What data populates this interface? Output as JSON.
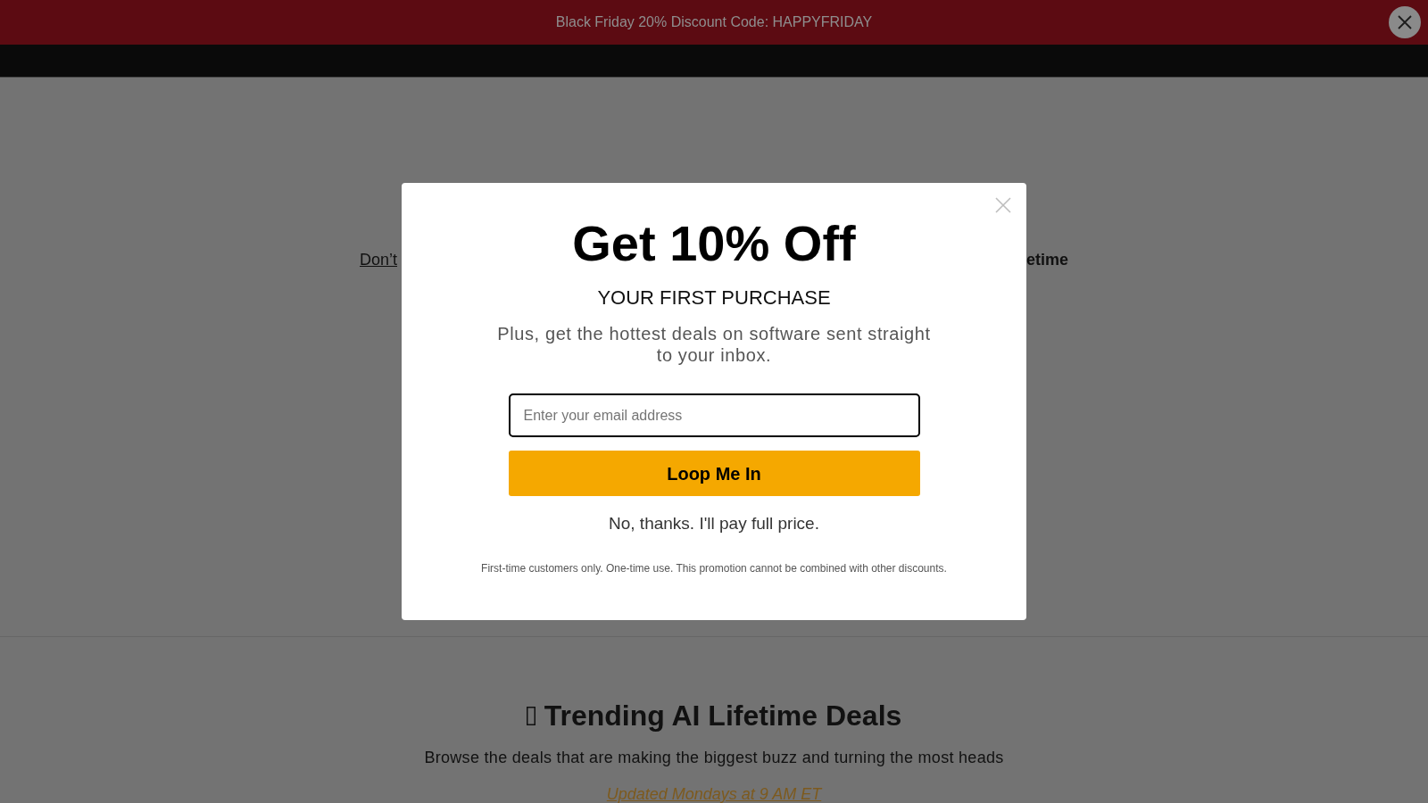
{
  "announcement_bar": {
    "text": "Black Friday 20% Discount Code: HAPPYFRIDAY"
  },
  "hero": {
    "subtitle_start": "Don’t",
    "subtitle_end": "etime"
  },
  "popup": {
    "title": "Get 10% Off",
    "subtitle": "YOUR FIRST PURCHASE",
    "description": "Plus, get the hottest deals on software sent straight to your inbox.",
    "email_field": {
      "placeholder": "Enter your email address"
    },
    "submit_button": "Loop Me In",
    "decline_link": "No, thanks. I'll pay full price.",
    "fine_print": "First-time customers only. One-time use. This promotion cannot be combined with other discounts."
  },
  "trending_section": {
    "title": "Trending AI Lifetime Deals",
    "description": "Browse the deals that are making the biggest buzz and turning the most heads",
    "update_note": "Updated Mondays at 9 AM ET"
  }
}
